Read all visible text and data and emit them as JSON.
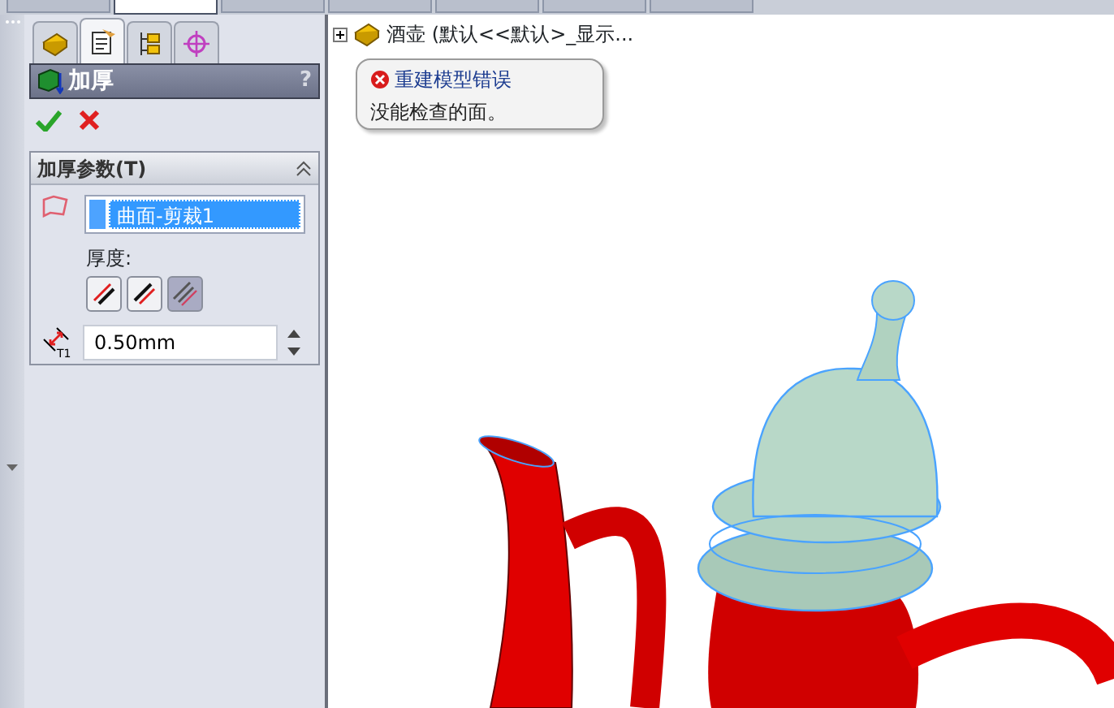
{
  "ribbon_tabs": [
    {
      "selected": false
    },
    {
      "selected": true
    },
    {
      "selected": false
    },
    {
      "selected": false
    },
    {
      "selected": false
    },
    {
      "selected": false
    },
    {
      "selected": false
    }
  ],
  "panel_tabs": [
    {
      "selected": false
    },
    {
      "selected": true
    },
    {
      "selected": false
    },
    {
      "selected": false
    }
  ],
  "feature": {
    "title": "加厚",
    "help": "?"
  },
  "group": {
    "title": "加厚参数(T)",
    "expanded": true,
    "selection": [
      {
        "label": "曲面-剪裁1",
        "selected": true
      }
    ],
    "thickness_label": "厚度:",
    "side_buttons": [
      {
        "selected": false
      },
      {
        "selected": false
      },
      {
        "selected": true
      }
    ],
    "thickness": {
      "symbol": "T1",
      "value": "0.50mm"
    }
  },
  "tree": {
    "items": [
      {
        "label": "酒壶 (默认<<默认>_显示...",
        "expanded": false
      }
    ]
  },
  "error_tooltip": {
    "title": "重建模型错误",
    "message": "没能检查的面。"
  }
}
